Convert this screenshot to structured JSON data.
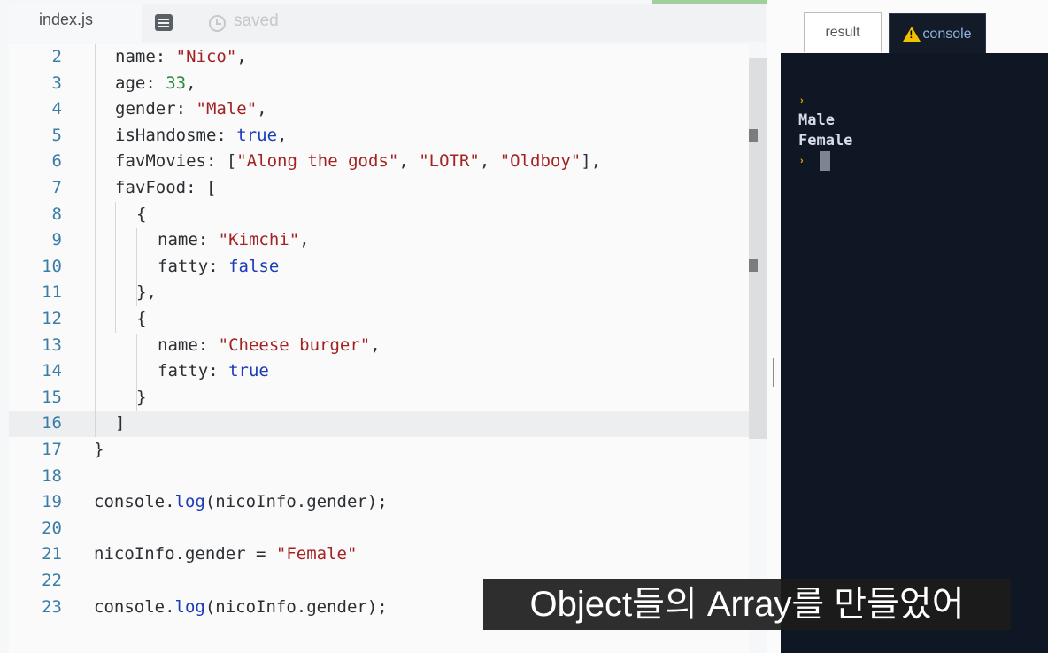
{
  "tabs": {
    "file": "index.js",
    "status": "saved",
    "result": "result",
    "console": "console"
  },
  "code_lines": [
    {
      "n": "2",
      "html": "<span class='tx' style='left:120px'>name: <span class='s'>\"Nico\"</span>,</span>"
    },
    {
      "n": "3",
      "html": "<span class='tx' style='left:120px'>age: <span class='n'>33</span>,</span>"
    },
    {
      "n": "4",
      "html": "<span class='tx' style='left:120px'>gender: <span class='s'>\"Male\"</span>,</span>"
    },
    {
      "n": "5",
      "html": "<span class='tx' style='left:120px'>isHandosme: <span class='k'>true</span>,</span>"
    },
    {
      "n": "6",
      "html": "<span class='tx' style='left:120px'>favMovies: [<span class='s'>\"Along the gods\"</span>, <span class='s'>\"LOTR\"</span>, <span class='s'>\"Oldboy\"</span>],</span>"
    },
    {
      "n": "7",
      "html": "<span class='tx' style='left:120px'>favFood: [</span>"
    },
    {
      "n": "8",
      "html": "<span class='tx' style='left:144px'>{</span>"
    },
    {
      "n": "9",
      "html": "<span class='tx' style='left:168px'>name: <span class='s'>\"Kimchi\"</span>,</span>"
    },
    {
      "n": "10",
      "html": "<span class='tx' style='left:168px'>fatty: <span class='k'>false</span></span>"
    },
    {
      "n": "11",
      "html": "<span class='tx' style='left:144px'>},</span>"
    },
    {
      "n": "12",
      "html": "<span class='tx' style='left:144px'>{</span>"
    },
    {
      "n": "13",
      "html": "<span class='tx' style='left:168px'>name: <span class='s'>\"Cheese burger\"</span>,</span>"
    },
    {
      "n": "14",
      "html": "<span class='tx' style='left:168px'>fatty: <span class='k'>true</span></span>"
    },
    {
      "n": "15",
      "html": "<span class='tx' style='left:144px'>}</span>"
    },
    {
      "n": "16",
      "html": "<span class='tx' style='left:120px'>]</span>"
    },
    {
      "n": "17",
      "html": "<span class='tx' style='left:96px'>}</span>"
    },
    {
      "n": "18",
      "html": ""
    },
    {
      "n": "19",
      "html": "<span class='tx' style='left:96px'>console.<span class='k'>log</span>(nicoInfo.gender);</span>"
    },
    {
      "n": "20",
      "html": ""
    },
    {
      "n": "21",
      "html": "<span class='tx' style='left:96px'>nicoInfo.gender = <span class='s'>\"Female\"</span></span>"
    },
    {
      "n": "22",
      "html": ""
    },
    {
      "n": "23",
      "html": "<span class='tx' style='left:96px'>console.<span class='k'>log</span>(nicoInfo.gender);</span>"
    }
  ],
  "console": {
    "output": [
      "Male",
      "Female"
    ],
    "prompt_glyph": "›"
  },
  "subtitle": "Object들의 Array를 만들었어"
}
